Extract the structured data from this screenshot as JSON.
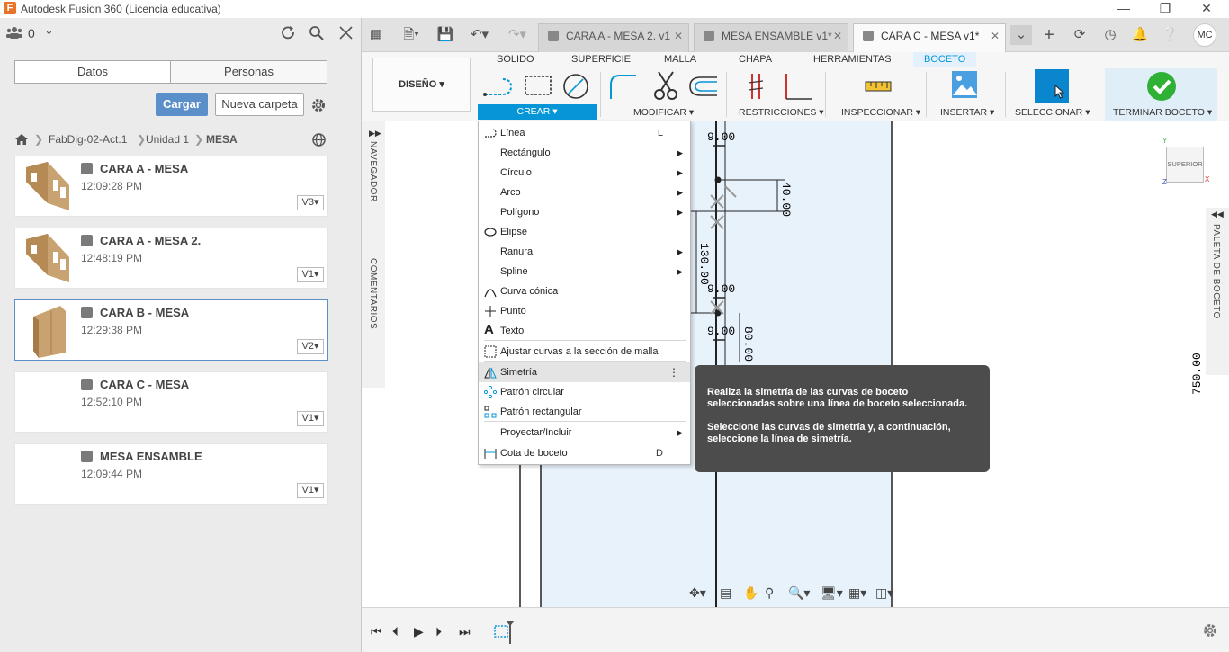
{
  "window": {
    "title": "Autodesk Fusion 360 (Licencia educativa)"
  },
  "left_panel": {
    "user_count": "0",
    "tabs": [
      "Datos",
      "Personas"
    ],
    "upload_label": "Cargar",
    "new_folder_label": "Nueva carpeta",
    "breadcrumb": [
      "FabDig-02-Act.1",
      "Unidad 1",
      "MESA"
    ],
    "files": [
      {
        "name": "CARA A - MESA",
        "time": "12:09:28 PM",
        "version": "V3"
      },
      {
        "name": "CARA A - MESA 2.",
        "time": "12:48:19 PM",
        "version": "V1"
      },
      {
        "name": "CARA B - MESA",
        "time": "12:29:38 PM",
        "version": "V2"
      },
      {
        "name": "CARA C - MESA",
        "time": "12:52:10 PM",
        "version": "V1"
      },
      {
        "name": "MESA ENSAMBLE",
        "time": "12:09:44 PM",
        "version": "V1"
      }
    ]
  },
  "doc_tabs": [
    {
      "label": "CARA A - MESA 2. v1"
    },
    {
      "label": "MESA ENSAMBLE v1*"
    },
    {
      "label": "CARA C - MESA v1*"
    }
  ],
  "user_initials": "MC",
  "ribbon": {
    "workspace": "DISEÑO",
    "tabs": [
      "SOLIDO",
      "SUPERFICIE",
      "MALLA",
      "CHAPA",
      "HERRAMIENTAS",
      "BOCETO"
    ],
    "groups": [
      "CREAR",
      "MODIFICAR",
      "RESTRICCIONES",
      "INSPECCIONAR",
      "INSERTAR",
      "SELECCIONAR",
      "TERMINAR BOCETO"
    ]
  },
  "side": {
    "navigator": "NAVEGADOR",
    "comments": "COMENTARIOS",
    "palette": "PALETA DE BOCETO",
    "viewcube": "SUPERIOR"
  },
  "menu": {
    "items": [
      {
        "label": "Línea",
        "shortcut": "L"
      },
      {
        "label": "Rectángulo",
        "submenu": true
      },
      {
        "label": "Círculo",
        "submenu": true
      },
      {
        "label": "Arco",
        "submenu": true
      },
      {
        "label": "Polígono",
        "submenu": true
      },
      {
        "label": "Elipse"
      },
      {
        "label": "Ranura",
        "submenu": true
      },
      {
        "label": "Spline",
        "submenu": true
      },
      {
        "label": "Curva cónica"
      },
      {
        "label": "Punto"
      },
      {
        "label": "Texto"
      },
      {
        "label": "Ajustar curvas a la sección de malla"
      },
      {
        "label": "Simetría"
      },
      {
        "label": "Patrón circular"
      },
      {
        "label": "Patrón rectangular"
      },
      {
        "label": "Proyectar/Incluir",
        "submenu": true
      },
      {
        "label": "Cota de boceto",
        "shortcut": "D"
      }
    ]
  },
  "tooltip": {
    "p1": "Realiza la simetría de las curvas de boceto seleccionadas sobre una línea de boceto seleccionada.",
    "p2": "Seleccione las curvas de simetría y, a continuación, seleccione la línea de simetría."
  },
  "dimensions": {
    "d1": "9.00",
    "d2": "40.00",
    "d3": "130.00",
    "d4": "9.00",
    "d5": "9.00",
    "d6": "80.00",
    "d7": "750.00"
  }
}
